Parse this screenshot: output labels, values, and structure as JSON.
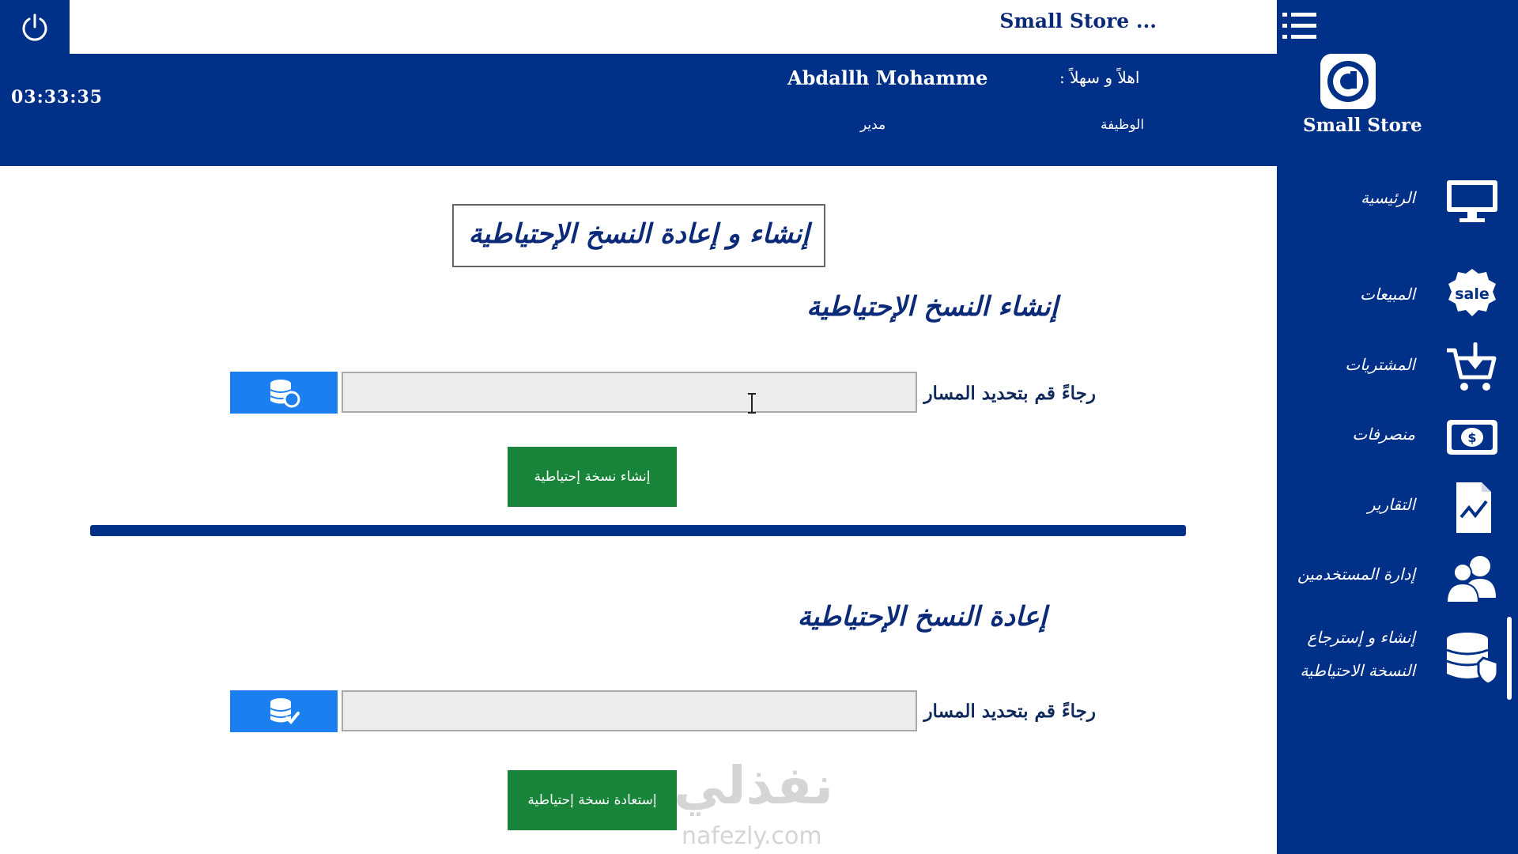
{
  "header": {
    "app_title": "Small Store ...",
    "welcome": "اهلاً و سهلاً :",
    "username": "Abdallh Mohamme",
    "job_label": "الوظيفة",
    "job_value": "مدير",
    "clock": "03:33:35",
    "brand": "Small Store"
  },
  "sidebar": {
    "items": [
      {
        "label": "الرئيسية",
        "icon": "monitor-icon"
      },
      {
        "label": "المبيعات",
        "icon": "sale-badge-icon"
      },
      {
        "label": "المشتريات",
        "icon": "cart-icon"
      },
      {
        "label": "منصرفات",
        "icon": "cash-icon"
      },
      {
        "label": "التقارير",
        "icon": "report-chart-icon"
      },
      {
        "label": "إدارة المستخدمين",
        "icon": "users-icon"
      },
      {
        "label_line1": "إنشاء و إسترجاع",
        "label_line2": "النسخة الاحتياطية",
        "icon": "database-shield-icon",
        "active": true
      }
    ]
  },
  "main": {
    "page_title": "إنشاء و إعادة النسخ الإحتياطية",
    "backup_section": {
      "title": "إنشاء النسخ الإحتياطية",
      "path_label": "رجاءً قم بتحديد المسار",
      "path_value": "",
      "button": "إنشاء نسخة إحتياطية"
    },
    "restore_section": {
      "title": "إعادة النسخ الإحتياطية",
      "path_label": "رجاءً قم بتحديد المسار",
      "path_value": "",
      "button": "إستعادة نسخة إحتياطية"
    }
  },
  "watermark": {
    "arabic": "نفذلي",
    "latin": "nafezly.com"
  },
  "colors": {
    "navy": "#003087",
    "browse_blue": "#1c7ff0",
    "green": "#18843a",
    "title_text": "#0b2a78"
  }
}
